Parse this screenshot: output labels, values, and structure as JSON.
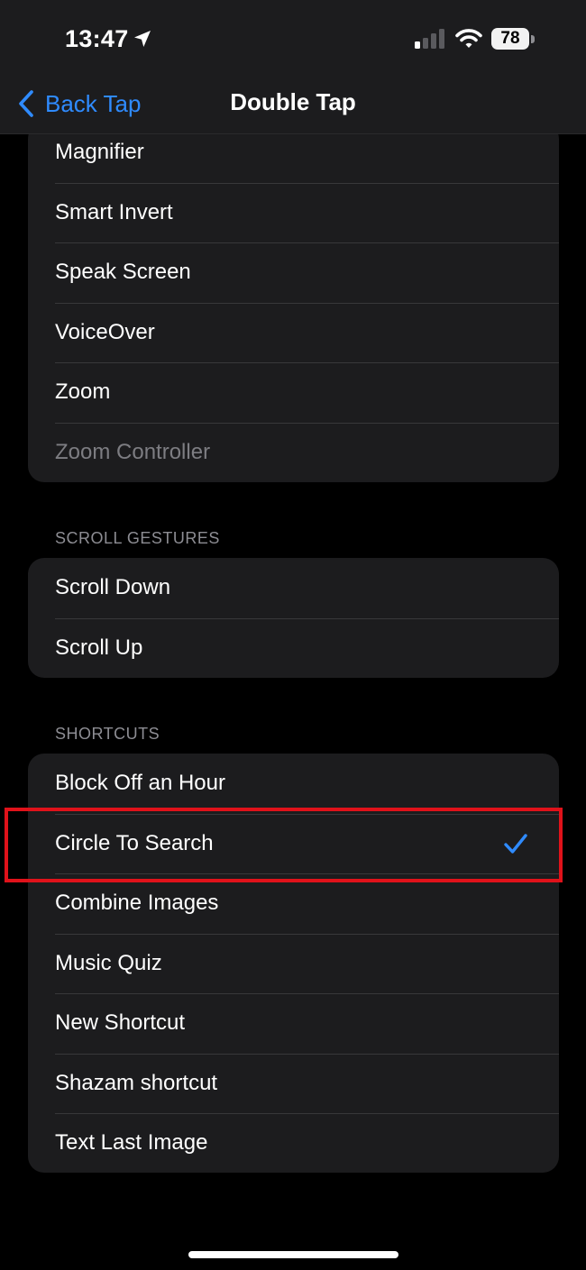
{
  "status_bar": {
    "time": "13:47",
    "battery_level": "78",
    "location_icon": "location-arrow-icon",
    "signal_icon": "cellular-signal-icon",
    "wifi_icon": "wifi-icon"
  },
  "nav": {
    "back_label": "Back Tap",
    "title": "Double Tap"
  },
  "accessibility_group": {
    "items": [
      {
        "label": "Magnifier"
      },
      {
        "label": "Smart Invert"
      },
      {
        "label": "Speak Screen"
      },
      {
        "label": "VoiceOver"
      },
      {
        "label": "Zoom"
      },
      {
        "label": "Zoom Controller",
        "dimmed": true
      }
    ]
  },
  "scroll_gestures": {
    "header": "SCROLL GESTURES",
    "items": [
      {
        "label": "Scroll Down"
      },
      {
        "label": "Scroll Up"
      }
    ]
  },
  "shortcuts": {
    "header": "SHORTCUTS",
    "items": [
      {
        "label": "Block Off an Hour"
      },
      {
        "label": "Circle To Search",
        "selected": true
      },
      {
        "label": "Combine Images"
      },
      {
        "label": "Music Quiz"
      },
      {
        "label": "New Shortcut"
      },
      {
        "label": "Shazam shortcut"
      },
      {
        "label": "Text Last Image"
      }
    ]
  },
  "colors": {
    "accent": "#2f8bff",
    "background": "#000000",
    "group_background": "#1c1c1e",
    "highlight": "#e0121a"
  }
}
